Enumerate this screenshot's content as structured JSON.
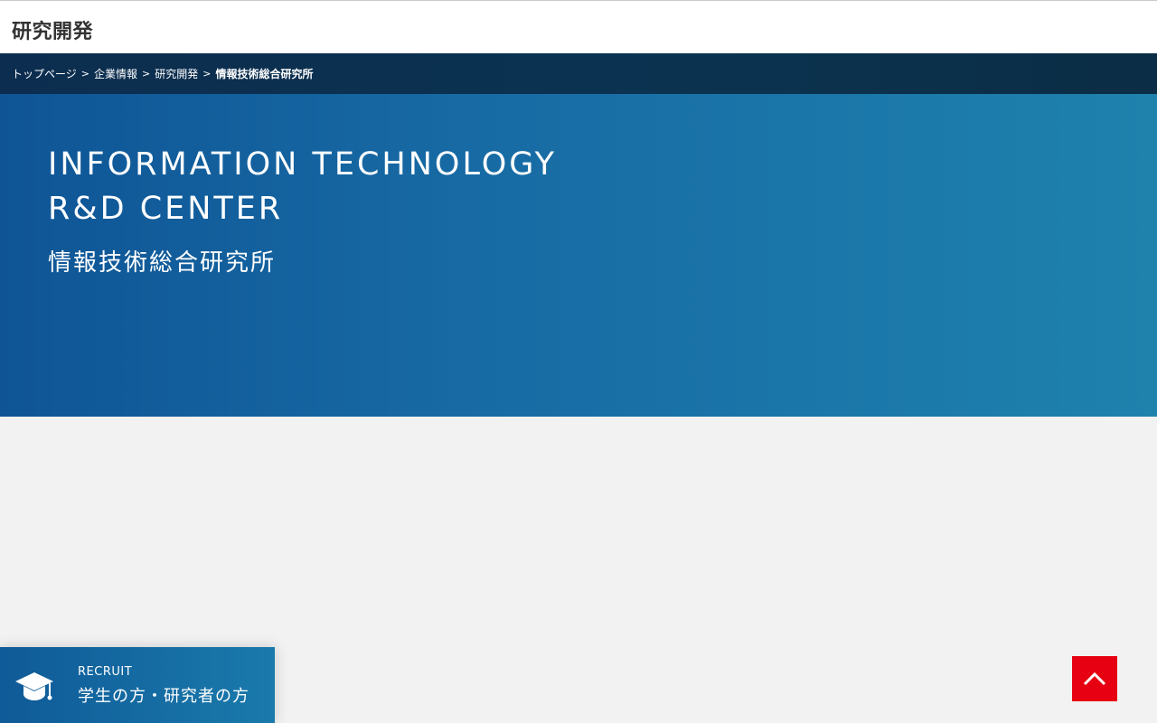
{
  "header": {
    "title": "研究開発"
  },
  "breadcrumb": {
    "separator": ">",
    "items": [
      {
        "label": "トップページ"
      },
      {
        "label": "企業情報"
      },
      {
        "label": "研究開発"
      },
      {
        "label": "情報技術総合研究所"
      }
    ]
  },
  "hero": {
    "title_en_line1": "INFORMATION TECHNOLOGY",
    "title_en_line2": "R&D CENTER",
    "title_ja": "情報技術総合研究所"
  },
  "recruit": {
    "label": "RECRUIT",
    "text": "学生の方・研究者の方",
    "icon": "graduation-cap-icon"
  },
  "back_to_top": {
    "icon": "chevron-up-icon"
  },
  "colors": {
    "hero_start": "#0f5596",
    "hero_end": "#1e82ad",
    "breadcrumb_bg": "#0b3350",
    "back_to_top": "#e60012",
    "page_bg": "#f2f2f2"
  }
}
